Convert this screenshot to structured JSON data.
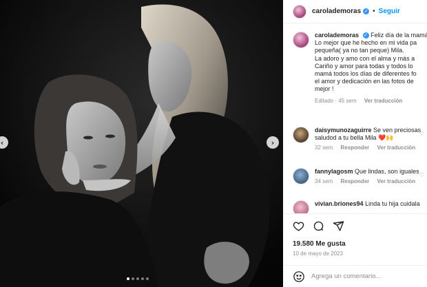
{
  "header": {
    "username": "carolademoras",
    "separator": "•",
    "follow_label": "Seguir"
  },
  "caption": {
    "username": "carolademoras",
    "lines": [
      "Feliz día de la mamá",
      "Lo mejor que he hecho en mi vida pa",
      "pequeña( ya no tan peque) Mila.",
      "La adoro y amo con el alma y más a",
      "Cariño y amor para todas y todos lo",
      "mamá todos los días de diferentes fo",
      "el amor y dedicación en las fotos de",
      "mejor !"
    ],
    "edited": "Editado · 45 sem",
    "translate": "Ver traducción"
  },
  "comments": [
    {
      "username": "daisymunozaguirre",
      "text_line1": "Se ven preciosas",
      "text_line2": "saludod a tu bella Mila ❤️🙌",
      "time": "32 sem",
      "reply": "Responder",
      "translate": "Ver traducción"
    },
    {
      "username": "fannylagosm",
      "text_line1": "Que lindas, son iguales",
      "time": "34 sem",
      "reply": "Responder",
      "translate": "Ver traducción"
    },
    {
      "username": "vivian.briones94",
      "text_line1": "Linda tu hija cuidala"
    }
  ],
  "stats": {
    "likes": "19.580 Me gusta",
    "date": "10 de mayo de 2023"
  },
  "compose": {
    "placeholder": "Agrega un comentario..."
  },
  "carousel": {
    "prev_icon": "chevron-left-icon",
    "next_icon": "chevron-right-icon",
    "slide_count": 5,
    "active_slide": 1
  },
  "colors": {
    "accent": "#0095f6",
    "verified": "#3897f0",
    "muted": "#8e8e8e"
  }
}
